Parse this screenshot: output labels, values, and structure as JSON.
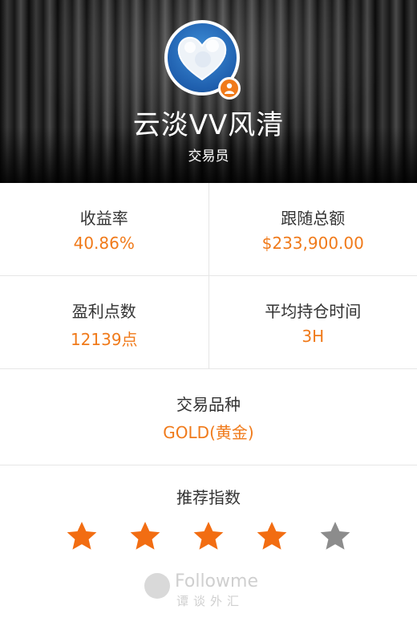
{
  "profile": {
    "name": "云淡VV风清",
    "role": "交易员"
  },
  "stats": [
    {
      "label": "收益率",
      "value": "40.86%"
    },
    {
      "label": "跟随总额",
      "value": "$233,900.00"
    },
    {
      "label": "盈利点数",
      "value": "12139点"
    },
    {
      "label": "平均持仓时间",
      "value": "3H"
    }
  ],
  "product": {
    "label": "交易品种",
    "value": "GOLD(黄金)"
  },
  "rating": {
    "label": "推荐指数",
    "stars_filled": 4,
    "stars_total": 5,
    "filled_color": "#f26d12",
    "empty_color": "#8c8c8c"
  },
  "footer": {
    "brand": "Followme",
    "tagline": "谭谈外汇"
  },
  "colors": {
    "accent": "#f07a1a"
  }
}
